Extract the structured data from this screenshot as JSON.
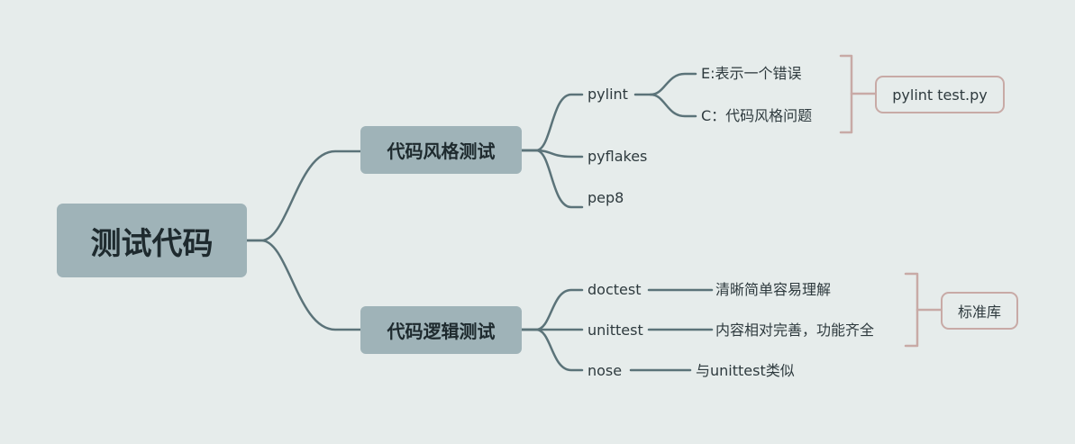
{
  "root": {
    "label": "测试代码"
  },
  "branches": [
    {
      "label": "代码风格测试",
      "children": [
        {
          "label": "pylint",
          "children": [
            {
              "label": "E:表示一个错误"
            },
            {
              "label": "C：代码风格问题"
            }
          ]
        },
        {
          "label": "pyflakes"
        },
        {
          "label": "pep8"
        }
      ],
      "callout": {
        "label": "pylint test.py"
      }
    },
    {
      "label": "代码逻辑测试",
      "children": [
        {
          "label": "doctest",
          "children": [
            {
              "label": "清晰简单容易理解"
            }
          ]
        },
        {
          "label": "unittest",
          "children": [
            {
              "label": "内容相对完善，功能齐全"
            }
          ]
        },
        {
          "label": "nose",
          "children": [
            {
              "label": "与unittest类似"
            }
          ]
        }
      ],
      "callout": {
        "label": "标准库"
      }
    }
  ],
  "colors": {
    "background": "#e6eceb",
    "node_fill": "#9fb3b8",
    "connector": "#5b7379",
    "bracket": "#c8aaa6"
  }
}
